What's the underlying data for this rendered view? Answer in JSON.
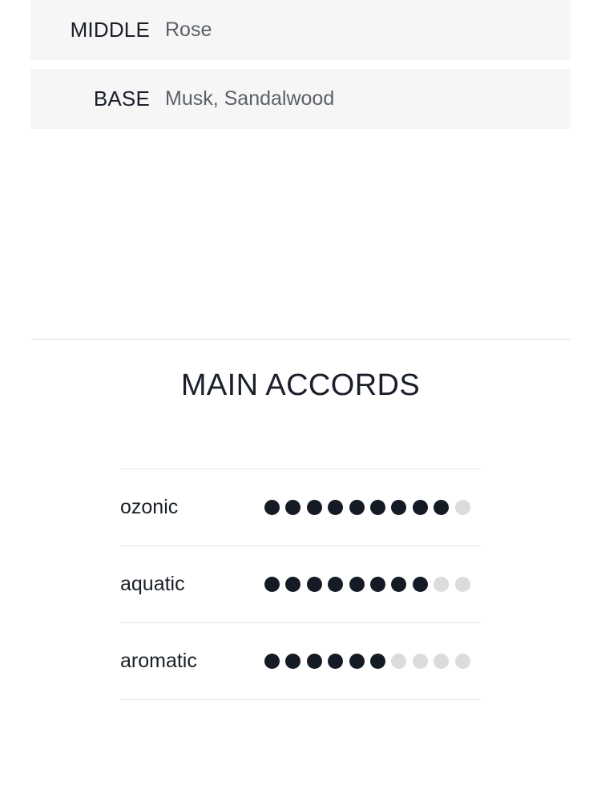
{
  "notes": {
    "rows": [
      {
        "label": "MIDDLE",
        "value": "Rose"
      },
      {
        "label": "BASE",
        "value": "Musk, Sandalwood"
      }
    ]
  },
  "accords": {
    "heading": "MAIN ACCORDS",
    "max_dots": 10,
    "items": [
      {
        "name": "ozonic",
        "filled": 9
      },
      {
        "name": "aquatic",
        "filled": 8
      },
      {
        "name": "aromatic",
        "filled": 6
      }
    ]
  },
  "colors": {
    "panel_background": "#f6f6f7",
    "text_primary": "#1a1f29",
    "text_secondary": "#5b6068",
    "dot_filled": "#151b25",
    "dot_empty": "#dcdcdd",
    "divider": "#e6e6e7"
  }
}
